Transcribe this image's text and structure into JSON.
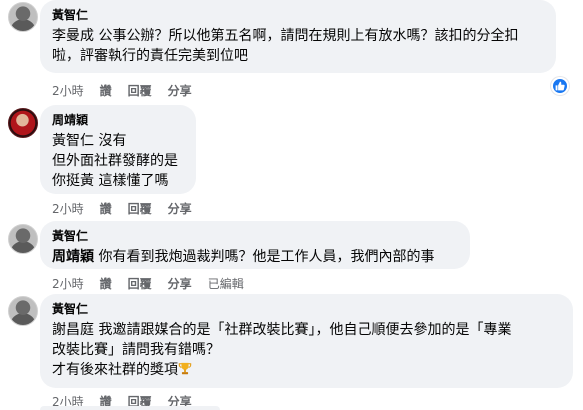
{
  "comments": [
    {
      "author": "黃智仁",
      "lines": [
        "李曼成 公事公辦？所以他第五名啊，請問在規則上有放水嗎？該扣的分全扣",
        "啦，評審執行的責任完美到位吧"
      ],
      "time": "2小時",
      "like": "讚",
      "reply": "回覆",
      "share": "分享"
    },
    {
      "author": "周靖穎",
      "mention": "黃智仁",
      "first_line_rest": " 沒有",
      "lines": [
        "但外面社群發酵的是",
        "你挺黃 這樣懂了嗎"
      ],
      "time": "2小時",
      "like": "讚",
      "reply": "回覆",
      "share": "分享"
    },
    {
      "author": "黃智仁",
      "mention": "周靖穎",
      "first_line_rest": " 你有看到我炮過裁判嗎？他是工作人員，我們內部的事",
      "time": "2小時",
      "like": "讚",
      "reply": "回覆",
      "share": "分享",
      "edited": "已編輯"
    },
    {
      "author": "黃智仁",
      "lines": [
        "謝昌庭 我邀請跟媒合的是「社群改裝比賽」，他自己順便去參加的是「專業",
        "改裝比賽」請問我有錯嗎？",
        "才有後來社群的獎項"
      ],
      "time": "2小時",
      "like": "讚",
      "reply": "回覆",
      "share": "分享"
    }
  ],
  "icons": {
    "like_reaction": "thumbs-up-icon",
    "trophy": "trophy-emoji-icon",
    "accent_color": "#1877f2"
  }
}
